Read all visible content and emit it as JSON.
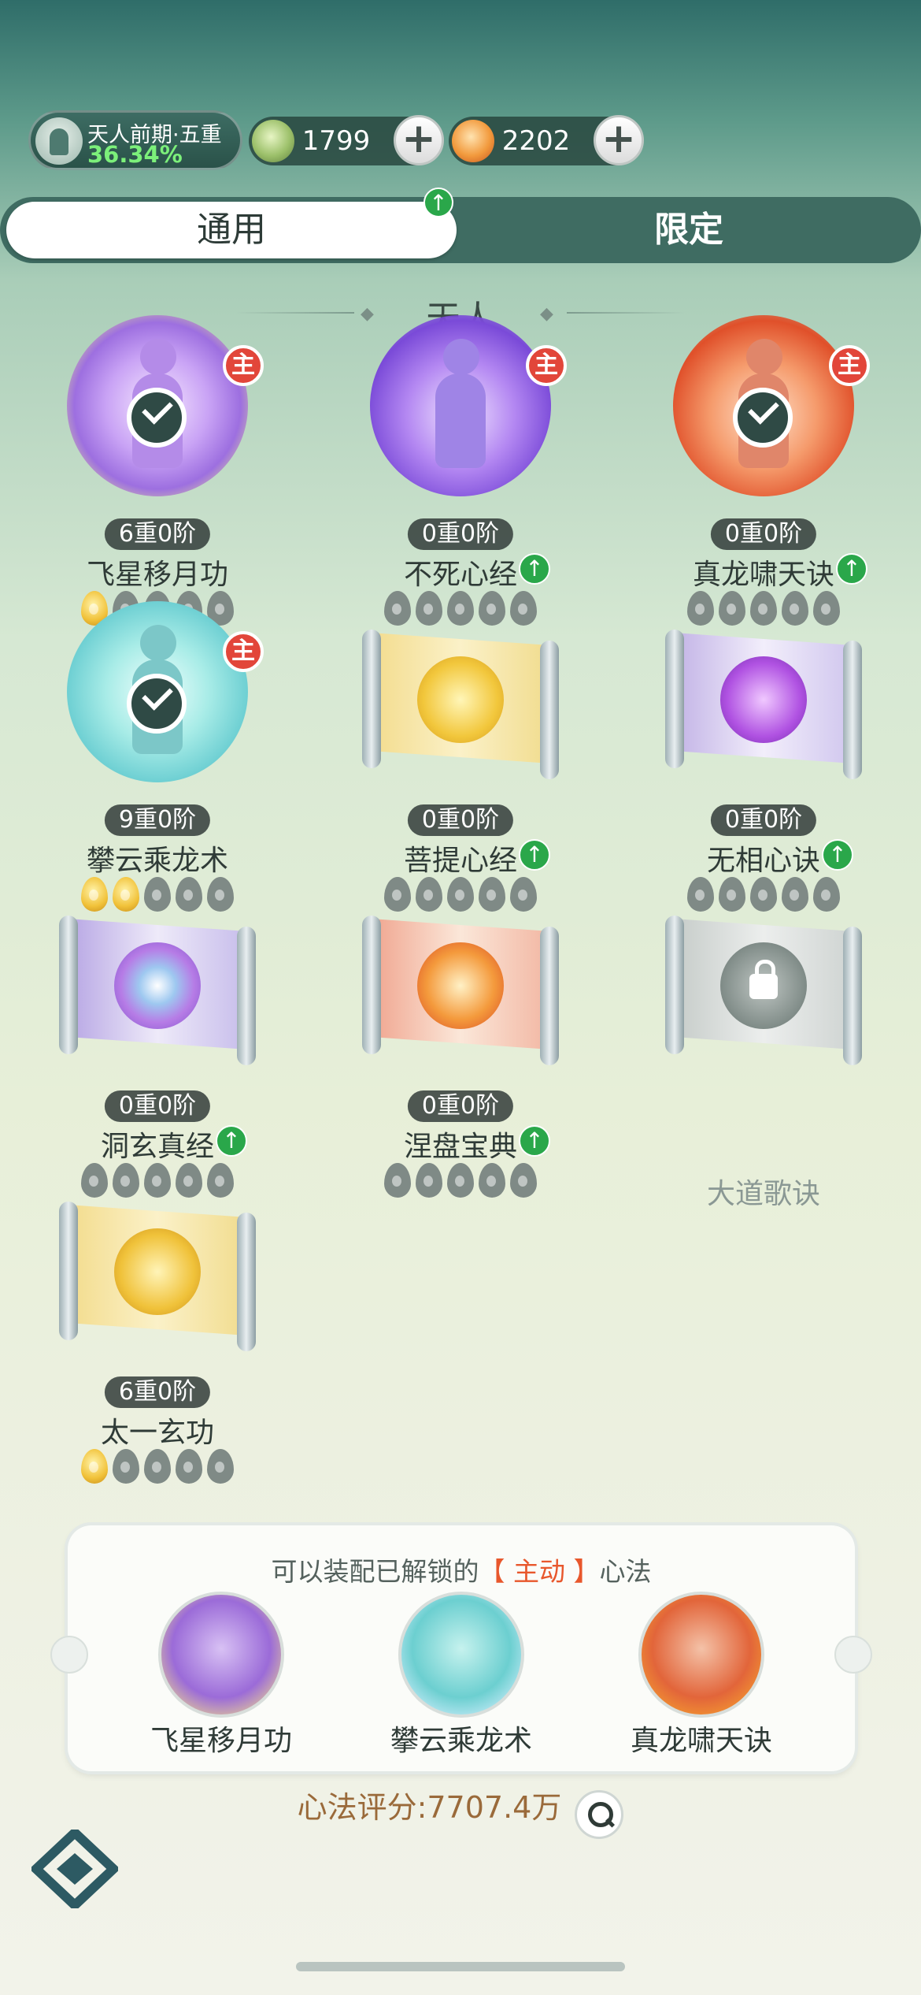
{
  "realm": {
    "name": "天人前期·五重",
    "progress": "36.34%"
  },
  "resources": [
    {
      "icon": "spirit-stone-icon",
      "value": "1799"
    },
    {
      "icon": "fire-essence-icon",
      "value": "2202"
    }
  ],
  "tabs": {
    "general": "通用",
    "limited": "限定",
    "active": "general"
  },
  "section_title": "天人",
  "main_badge": "主",
  "skills": [
    {
      "name": "飞星移月功",
      "level": "6重0阶",
      "main": true,
      "equipped": true,
      "upgrade": false,
      "lit": 1,
      "total": 5,
      "theme": "purple-moon"
    },
    {
      "name": "不死心经",
      "level": "0重0阶",
      "main": true,
      "equipped": false,
      "upgrade": true,
      "lit": 0,
      "total": 5,
      "theme": "violet-lotus"
    },
    {
      "name": "真龙啸天诀",
      "level": "0重0阶",
      "main": true,
      "equipped": true,
      "upgrade": true,
      "lit": 0,
      "total": 5,
      "theme": "fire-dragon"
    },
    {
      "name": "攀云乘龙术",
      "level": "9重0阶",
      "main": true,
      "equipped": true,
      "upgrade": false,
      "lit": 2,
      "total": 5,
      "theme": "cyan-cloud"
    },
    {
      "name": "菩提心经",
      "level": "0重0阶",
      "main": false,
      "equipped": false,
      "upgrade": true,
      "lit": 0,
      "total": 5,
      "theme": "gold-lotus-scroll"
    },
    {
      "name": "无相心诀",
      "level": "0重0阶",
      "main": false,
      "equipped": false,
      "upgrade": true,
      "lit": 0,
      "total": 5,
      "theme": "purple-flame-scroll"
    },
    {
      "name": "洞玄真经",
      "level": "0重0阶",
      "main": false,
      "equipped": false,
      "upgrade": true,
      "lit": 0,
      "total": 5,
      "theme": "vortex-scroll"
    },
    {
      "name": "涅盘宝典",
      "level": "0重0阶",
      "main": false,
      "equipped": false,
      "upgrade": true,
      "lit": 0,
      "total": 5,
      "theme": "phoenix-scroll"
    },
    {
      "name": "大道歌诀",
      "level": "",
      "main": false,
      "equipped": false,
      "upgrade": false,
      "lit": 0,
      "total": 0,
      "locked": true,
      "theme": "locked-scroll"
    },
    {
      "name": "太一玄功",
      "level": "6重0阶",
      "main": false,
      "equipped": false,
      "upgrade": false,
      "lit": 1,
      "total": 5,
      "theme": "gold-dragon-scroll"
    }
  ],
  "equip_panel": {
    "hint_prefix": "可以装配已解锁的",
    "hint_highlight": "【 主动 】",
    "hint_suffix": "心法",
    "slots": [
      "飞星移月功",
      "攀云乘龙术",
      "真龙啸天诀"
    ]
  },
  "score": {
    "label": "心法评分:7707.4万"
  },
  "colors": {
    "accent_green": "#2aa74a",
    "badge_red": "#e2463a",
    "highlight_orange": "#e8572c"
  }
}
